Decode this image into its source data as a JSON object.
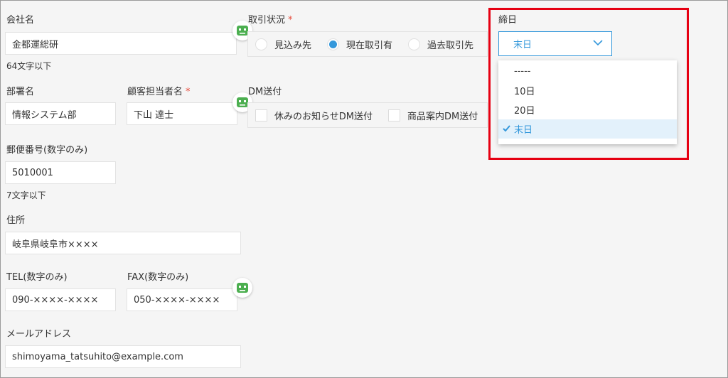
{
  "company": {
    "label": "会社名",
    "value": "金都運総研",
    "hint": "64文字以下"
  },
  "deal_status": {
    "label": "取引状況",
    "required_mark": "*",
    "options": [
      {
        "label": "見込み先",
        "selected": false
      },
      {
        "label": "現在取引有",
        "selected": true
      },
      {
        "label": "過去取引先",
        "selected": false
      }
    ]
  },
  "closing_day": {
    "label": "締日",
    "selected_value": "末日",
    "options": [
      {
        "label": "-----",
        "selected": false
      },
      {
        "label": "10日",
        "selected": false
      },
      {
        "label": "20日",
        "selected": false
      },
      {
        "label": "末日",
        "selected": true
      }
    ]
  },
  "department": {
    "label": "部署名",
    "value": "情報システム部"
  },
  "contact": {
    "label": "顧客担当者名",
    "required_mark": "*",
    "value": "下山 達士"
  },
  "dm": {
    "label": "DM送付",
    "options": [
      {
        "label": "休みのお知らせDM送付",
        "checked": false
      },
      {
        "label": "商品案内DM送付",
        "checked": false
      }
    ]
  },
  "postal": {
    "label": "郵便番号(数字のみ)",
    "value": "5010001",
    "hint": "7文字以下"
  },
  "address": {
    "label": "住所",
    "value": "岐阜県岐阜市××××"
  },
  "tel": {
    "label": "TEL(数字のみ)",
    "value": "090-××××-××××"
  },
  "fax": {
    "label": "FAX(数字のみ)",
    "value": "050-××××-××××"
  },
  "email": {
    "label": "メールアドレス",
    "value": "shimoyama_tatsuhito@example.com"
  },
  "colors": {
    "accent": "#3498db",
    "required": "#e74c3c",
    "highlight": "#e60012",
    "robot": "#4caf50"
  },
  "icons": {
    "lookup": "robot-icon",
    "dropdown": "chevron-down-icon",
    "selected": "check-icon"
  }
}
